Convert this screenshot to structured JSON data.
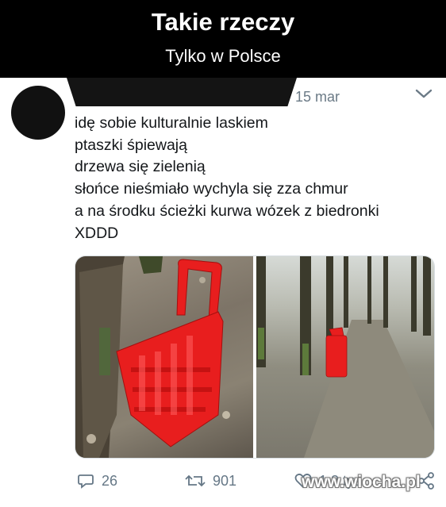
{
  "header": {
    "title": "Takie rzeczy",
    "subtitle": "Tylko w Polsce"
  },
  "tweet": {
    "date": "15 mar",
    "lines": [
      "idę sobie kulturalnie laskiem",
      "ptaszki śpiewają",
      "drzewa się zielenią",
      "słońce nieśmiało wychyla się zza chmur",
      "a na środku ścieżki kurwa wózek z biedronki",
      "XDDD"
    ],
    "photos": [
      "red-shopping-trolley-near-tree-photo",
      "red-shopping-trolley-on-forest-path-photo"
    ],
    "actions": {
      "replies": "26",
      "retweets": "901",
      "likes": "1,3 tys."
    }
  },
  "watermark": "www.wiocha.pl",
  "colors": {
    "header_bg": "#000000",
    "text": "#14171a",
    "muted": "#657786",
    "trolley_red": "#e81e1e"
  },
  "icons": [
    "reply-icon",
    "retweet-icon",
    "like-icon",
    "share-icon",
    "chevron-down-icon"
  ]
}
